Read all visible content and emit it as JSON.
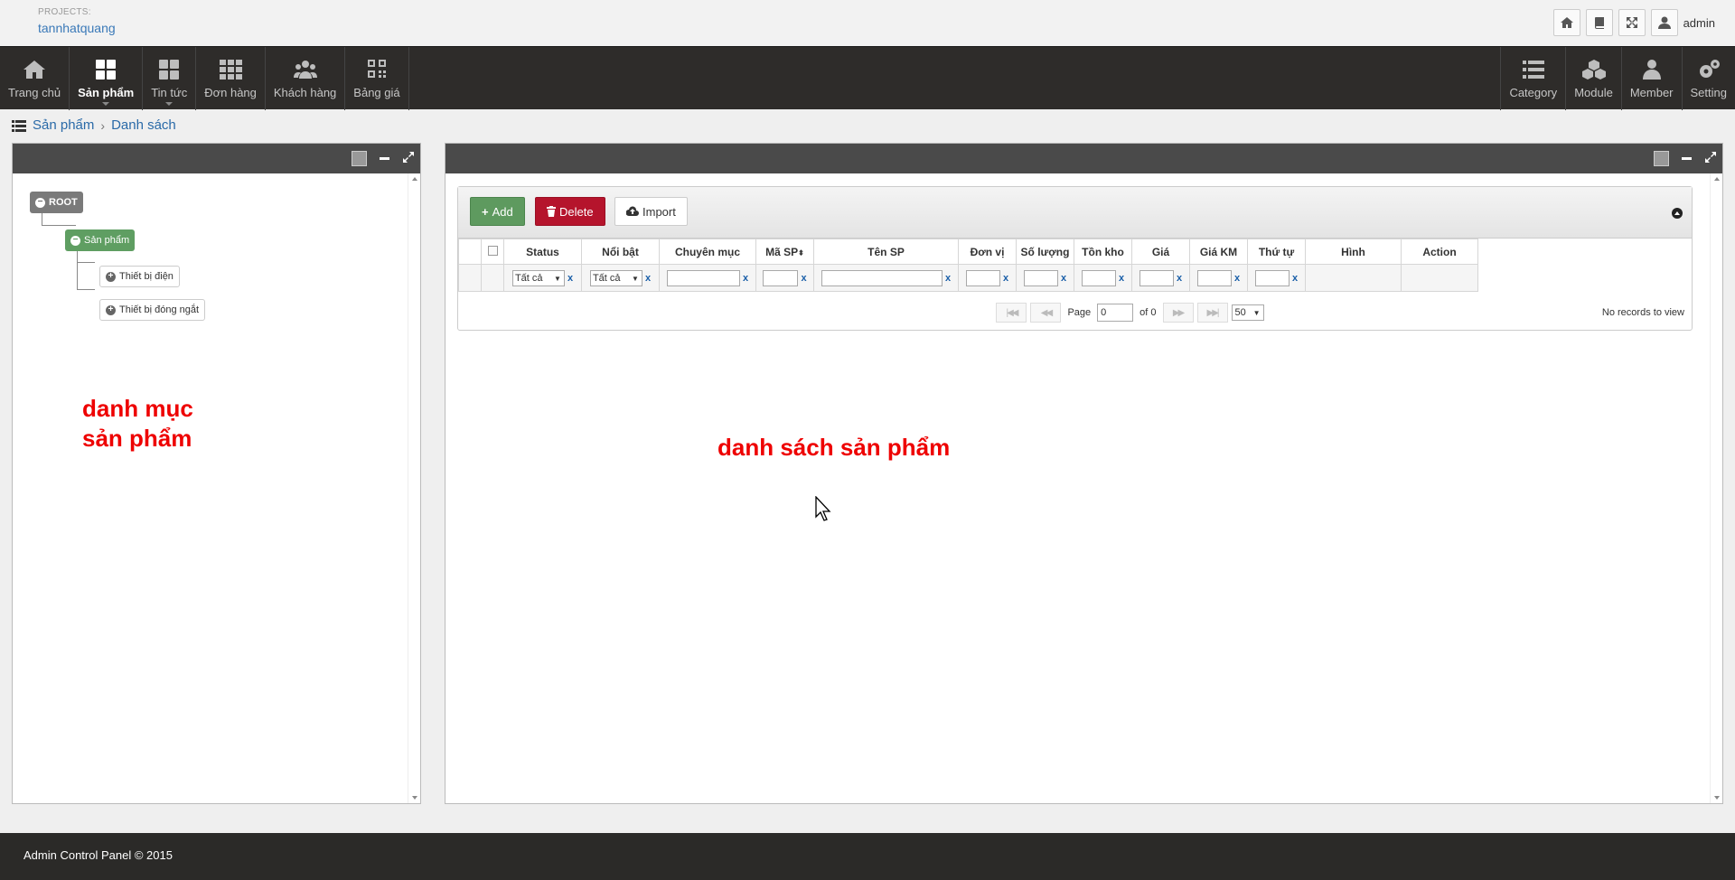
{
  "header": {
    "projects_label": "PROJECTS:",
    "project_name": "tannhatquang",
    "user_name": "admin"
  },
  "nav": {
    "left": [
      {
        "label": "Trang chủ",
        "icon": "home-icon"
      },
      {
        "label": "Sản phẩm",
        "icon": "grid-icon",
        "active": true
      },
      {
        "label": "Tin tức",
        "icon": "grid-icon"
      },
      {
        "label": "Đơn hàng",
        "icon": "apps-icon"
      },
      {
        "label": "Khách hàng",
        "icon": "users-icon"
      },
      {
        "label": "Bảng giá",
        "icon": "qr-icon"
      }
    ],
    "right": [
      {
        "label": "Category",
        "icon": "list-icon"
      },
      {
        "label": "Module",
        "icon": "cubes-icon"
      },
      {
        "label": "Member",
        "icon": "user-icon"
      },
      {
        "label": "Setting",
        "icon": "gears-icon"
      }
    ]
  },
  "breadcrumb": {
    "items": [
      "Sản phẩm",
      "Danh sách"
    ],
    "separator": "›"
  },
  "tree": {
    "root": "ROOT",
    "selected": "Sản phẩm",
    "children": [
      "Thiết bị điện",
      "Thiết bị đóng ngắt"
    ]
  },
  "annotations": {
    "left_line1": "danh mục",
    "left_line2": "sản phẩm",
    "right": "danh sách sản phẩm",
    "color": "#ee0000"
  },
  "grid": {
    "buttons": {
      "add": "Add",
      "delete": "Delete",
      "import": "Import"
    },
    "columns": [
      "Status",
      "Nổi bật",
      "Chuyên mục",
      "Mã SP",
      "Tên SP",
      "Đơn vị",
      "Số lượng",
      "Tồn kho",
      "Giá",
      "Giá KM",
      "Thứ tự",
      "Hình",
      "Action"
    ],
    "filters": {
      "status": "Tất cả",
      "noibat": "Tất cả",
      "clear": "x"
    },
    "pager": {
      "page_label": "Page",
      "page_value": "0",
      "of_label": "of 0",
      "page_size": "50",
      "no_records": "No records to view"
    }
  },
  "footer": {
    "text": "Admin Control Panel © 2015"
  },
  "colors": {
    "navbar": "#2e2c2a",
    "link": "#3a79b8",
    "add": "#5e9a5f",
    "delete": "#b5142c"
  }
}
